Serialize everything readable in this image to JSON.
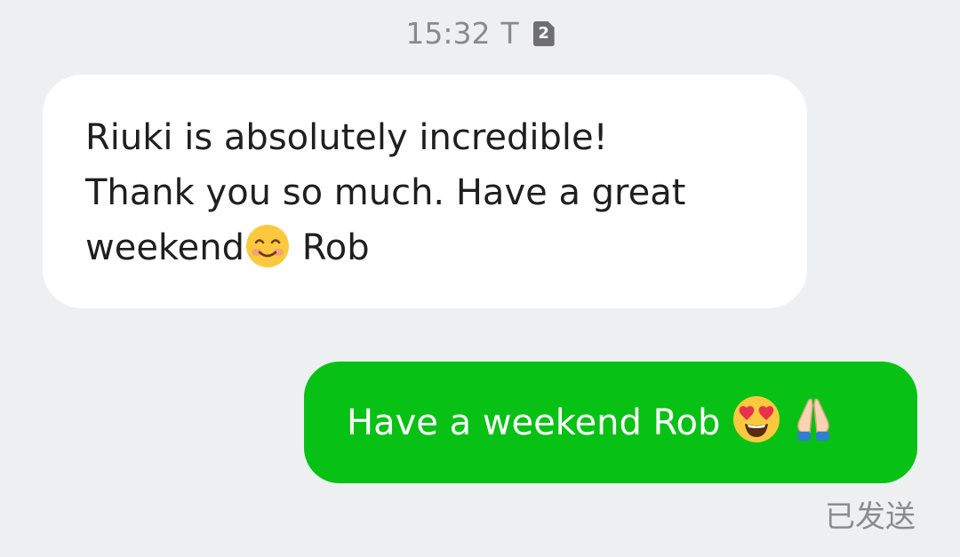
{
  "header": {
    "time": "15:32",
    "carrier": "T",
    "sim_slot": "2"
  },
  "messages": [
    {
      "direction": "incoming",
      "lines": [
        "Riuki is absolutely incredible!",
        "Thank you so much. Have a great",
        "weekend"
      ],
      "emoji_inline": "smiling-face-with-smiling-eyes",
      "after_emoji": " Rob"
    },
    {
      "direction": "outgoing",
      "text": "Have a weekend Rob ",
      "emojis": [
        "smiling-face-with-heart-eyes",
        "folded-hands"
      ],
      "status": "已发送"
    }
  ],
  "colors": {
    "background": "#eeeff1",
    "incoming_bubble": "#ffffff",
    "outgoing_bubble": "#07c115",
    "status_text": "#8c8c8c"
  }
}
